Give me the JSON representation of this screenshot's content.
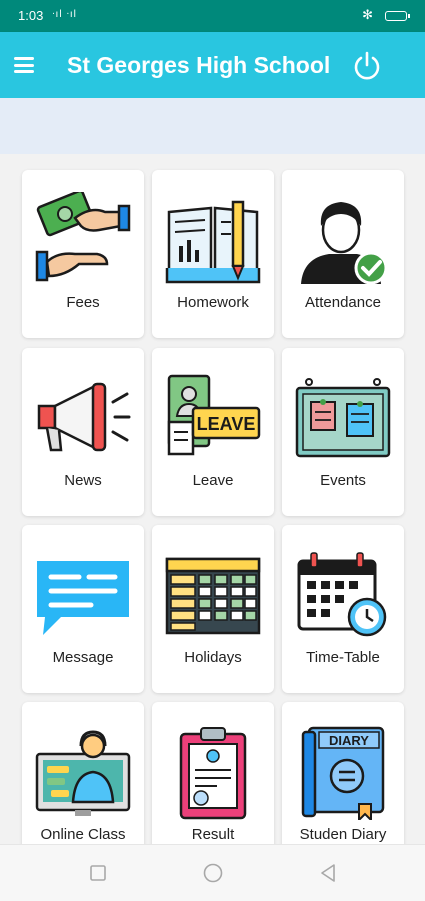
{
  "status_bar": {
    "time": "1:03",
    "signal_text": "ᐧıl ᐧıl",
    "bluetooth": "✻"
  },
  "app_bar": {
    "title": "St Georges High School"
  },
  "tiles": [
    {
      "label": "Fees",
      "icon": "fees-icon"
    },
    {
      "label": "Homework",
      "icon": "homework-icon"
    },
    {
      "label": "Attendance",
      "icon": "attendance-icon"
    },
    {
      "label": "News",
      "icon": "news-icon"
    },
    {
      "label": "Leave",
      "icon": "leave-icon",
      "badge_text": "LEAVE"
    },
    {
      "label": "Events",
      "icon": "events-icon"
    },
    {
      "label": "Message",
      "icon": "message-icon"
    },
    {
      "label": "Holidays",
      "icon": "holidays-icon"
    },
    {
      "label": "Time-Table",
      "icon": "timetable-icon"
    },
    {
      "label": "Online Class",
      "icon": "online-class-icon"
    },
    {
      "label": "Result",
      "icon": "result-icon"
    },
    {
      "label": "Studen Diary",
      "icon": "diary-icon",
      "badge_text": "DIARY"
    }
  ],
  "colors": {
    "status_bar": "#00897b",
    "app_bar": "#29c6e0",
    "banner": "#e4ecf7",
    "background": "#f2f2f2"
  }
}
